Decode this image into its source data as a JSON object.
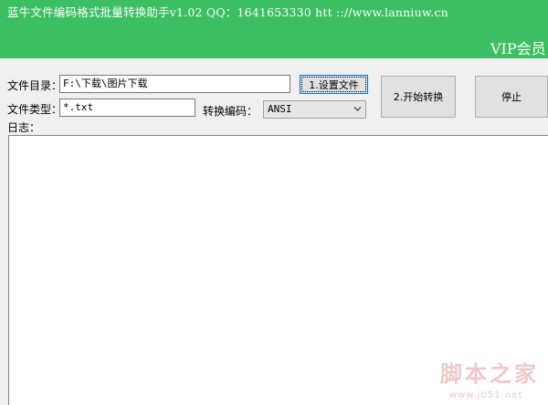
{
  "window": {
    "title": "蓝牛文件编码格式批量转换助手v1.02   QQ：1641653330   htt :://www.lanniuw.cn",
    "vip": "VIP会员"
  },
  "form": {
    "dir_label": "文件目录：",
    "dir_value": "F:\\下载\\图片下载",
    "type_label": "文件类型：",
    "type_value": "*.txt",
    "encoding_label": "转换编码：",
    "encoding_value": "ANSI",
    "log_label": "日志：",
    "log_content": ""
  },
  "buttons": {
    "set_files": "1.设置文件",
    "start": "2.开始转换",
    "stop": "停止"
  },
  "watermark": {
    "text": "脚本之家",
    "url": "www.jb51.net"
  },
  "colors": {
    "titlebar": "#3cbf62",
    "focus_border": "#0078d7",
    "watermark": "#f0cccc"
  }
}
